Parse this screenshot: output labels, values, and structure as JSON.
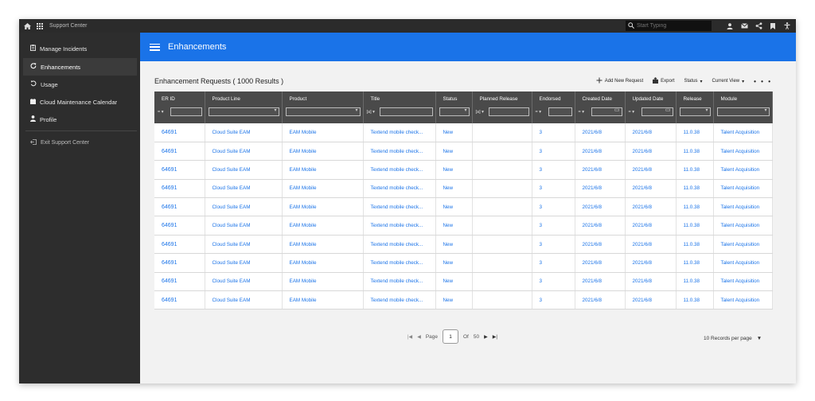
{
  "topbar": {
    "app_title": "Support Center",
    "search_placeholder": "Start Typing"
  },
  "sidebar": {
    "items": [
      {
        "label": "Manage Incidents"
      },
      {
        "label": "Enhancements"
      },
      {
        "label": "Usage"
      },
      {
        "label": "Cloud Maintenance Calendar"
      },
      {
        "label": "Profile"
      }
    ],
    "exit_label": "Exit Support Center"
  },
  "banner": {
    "title": "Enhancements"
  },
  "toolbar": {
    "title": "Enhancement Requests ( 1000 Results )",
    "add_label": "Add New Request",
    "export_label": "Export",
    "status_label": "Status",
    "view_label": "Current View",
    "more_label": "• • •"
  },
  "table": {
    "columns": [
      "ER ID",
      "Product Line",
      "Product",
      "Title",
      "Status",
      "Planned Release",
      "Endorsed",
      "Created Date",
      "Updated Date",
      "Release",
      "Module"
    ],
    "rows": [
      [
        "64691",
        "Cloud Suite EAM",
        "EAM Mobile",
        "Textend mobile check...",
        "New",
        "",
        "3",
        "2021/6/8",
        "2021/6/8",
        "11.0.38",
        "Talent Acquisition"
      ],
      [
        "64691",
        "Cloud Suite EAM",
        "EAM Mobile",
        "Textend mobile check...",
        "New",
        "",
        "3",
        "2021/6/8",
        "2021/6/8",
        "11.0.38",
        "Talent Acquisition"
      ],
      [
        "64691",
        "Cloud Suite EAM",
        "EAM Mobile",
        "Textend mobile check...",
        "New",
        "",
        "3",
        "2021/6/8",
        "2021/6/8",
        "11.0.38",
        "Talent Acquisition"
      ],
      [
        "64691",
        "Cloud Suite EAM",
        "EAM Mobile",
        "Textend mobile check...",
        "New",
        "",
        "3",
        "2021/6/8",
        "2021/6/8",
        "11.0.38",
        "Talent Acquisition"
      ],
      [
        "64691",
        "Cloud Suite EAM",
        "EAM Mobile",
        "Textend mobile check...",
        "New",
        "",
        "3",
        "2021/6/8",
        "2021/6/8",
        "11.0.38",
        "Talent Acquisition"
      ],
      [
        "64691",
        "Cloud Suite EAM",
        "EAM Mobile",
        "Textend mobile check...",
        "New",
        "",
        "3",
        "2021/6/8",
        "2021/6/8",
        "11.0.38",
        "Talent Acquisition"
      ],
      [
        "64691",
        "Cloud Suite EAM",
        "EAM Mobile",
        "Textend mobile check...",
        "New",
        "",
        "3",
        "2021/6/8",
        "2021/6/8",
        "11.0.38",
        "Talent Acquisition"
      ],
      [
        "64691",
        "Cloud Suite EAM",
        "EAM Mobile",
        "Textend mobile check...",
        "New",
        "",
        "3",
        "2021/6/8",
        "2021/6/8",
        "11.0.38",
        "Talent Acquisition"
      ],
      [
        "64691",
        "Cloud Suite EAM",
        "EAM Mobile",
        "Textend mobile check...",
        "New",
        "",
        "3",
        "2021/6/8",
        "2021/6/8",
        "11.0.38",
        "Talent Acquisition"
      ],
      [
        "64691",
        "Cloud Suite EAM",
        "EAM Mobile",
        "Textend mobile check...",
        "New",
        "",
        "3",
        "2021/6/8",
        "2021/6/8",
        "11.0.38",
        "Talent Acquisition"
      ]
    ]
  },
  "pager": {
    "page_label": "Page",
    "current_page": "1",
    "of_label": "Of",
    "total_pages": "50",
    "per_page_label": "10 Records per page"
  },
  "colors": {
    "accent": "#1a73e8",
    "header_bg": "#4a4a4a",
    "sidebar_bg": "#2d2d2d",
    "topbar_bg": "#2b2b2b"
  }
}
